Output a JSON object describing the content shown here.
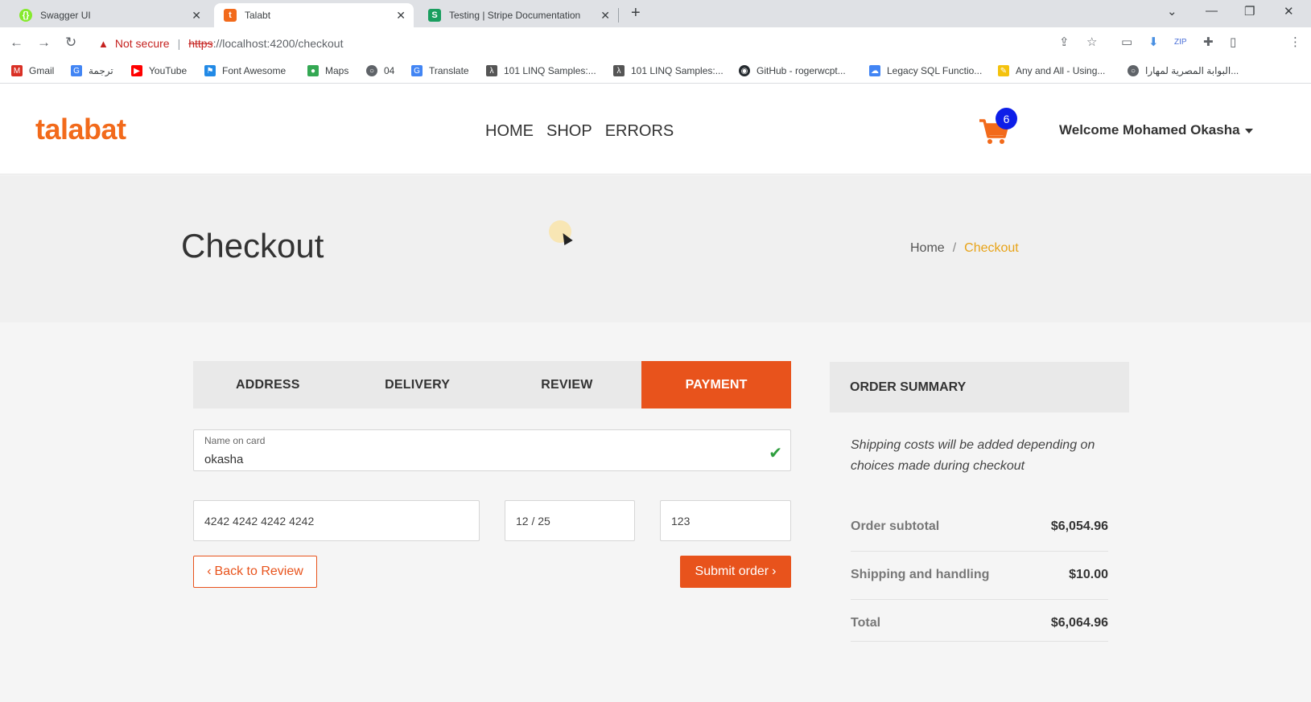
{
  "browser": {
    "tabs": [
      {
        "title": "Swagger UI",
        "favicon": "swagger-icon",
        "color": "#85ea2d"
      },
      {
        "title": "Talabt",
        "favicon": "talabat-icon",
        "color": "#f26a1b",
        "active": true
      },
      {
        "title": "Testing | Stripe Documentation",
        "favicon": "stripe-docs-icon",
        "color": "#1a9e5f"
      }
    ],
    "security_label": "Not secure",
    "url_scheme": "https",
    "url_rest": "://localhost:4200/checkout",
    "bookmarks": [
      {
        "label": "Gmail",
        "icon": "gmail-icon",
        "color": "#d93025"
      },
      {
        "label": "ترجمة",
        "icon": "translate-icon",
        "color": "#4285f4"
      },
      {
        "label": "YouTube",
        "icon": "youtube-icon",
        "color": "#ff0000"
      },
      {
        "label": "Font Awesome",
        "icon": "font-awesome-icon",
        "color": "#228ae6"
      },
      {
        "label": "Maps",
        "icon": "maps-icon",
        "color": "#34a853"
      },
      {
        "label": "04",
        "icon": "globe-icon",
        "color": "#5f6368"
      },
      {
        "label": "Translate",
        "icon": "translate-icon",
        "color": "#4285f4"
      },
      {
        "label": "101 LINQ Samples:...",
        "icon": "linq-icon",
        "color": "#555555"
      },
      {
        "label": "101 LINQ Samples:...",
        "icon": "linq-icon",
        "color": "#555555"
      },
      {
        "label": "GitHub - rogerwcpt...",
        "icon": "github-icon",
        "color": "#24292e"
      },
      {
        "label": "Legacy SQL Functio...",
        "icon": "cloud-icon",
        "color": "#4285f4"
      },
      {
        "label": "Any and All - Using...",
        "icon": "pencil-icon",
        "color": "#f4c20d"
      },
      {
        "label": "البوابة المصرية لمهارا...",
        "icon": "globe-icon",
        "color": "#5f6368"
      }
    ]
  },
  "site": {
    "logo": "talabat",
    "nav": [
      "HOME",
      "SHOP",
      "ERRORS"
    ],
    "cart_count": "6",
    "welcome": "Welcome Mohamed Okasha",
    "brand_color": "#f26a1b",
    "accent_color": "#e8531c"
  },
  "banner": {
    "title": "Checkout",
    "breadcrumb_home": "Home",
    "breadcrumb_separator": "/",
    "breadcrumb_current": "Checkout"
  },
  "checkout": {
    "steps": [
      "ADDRESS",
      "DELIVERY",
      "REVIEW",
      "PAYMENT"
    ],
    "active_step": "PAYMENT",
    "name_on_card_label": "Name on card",
    "name_on_card_value": "okasha",
    "card_number": "4242 4242 4242 4242",
    "expiry": "12 / 25",
    "cvc": "123",
    "back_button": "Back to Review",
    "submit_button": "Submit order"
  },
  "summary": {
    "title": "ORDER SUMMARY",
    "note": "Shipping costs will be added depending on choices made during checkout",
    "rows": [
      {
        "label": "Order subtotal",
        "amount": "$6,054.96"
      },
      {
        "label": "Shipping and handling",
        "amount": "$10.00"
      },
      {
        "label": "Total",
        "amount": "$6,064.96"
      }
    ]
  }
}
